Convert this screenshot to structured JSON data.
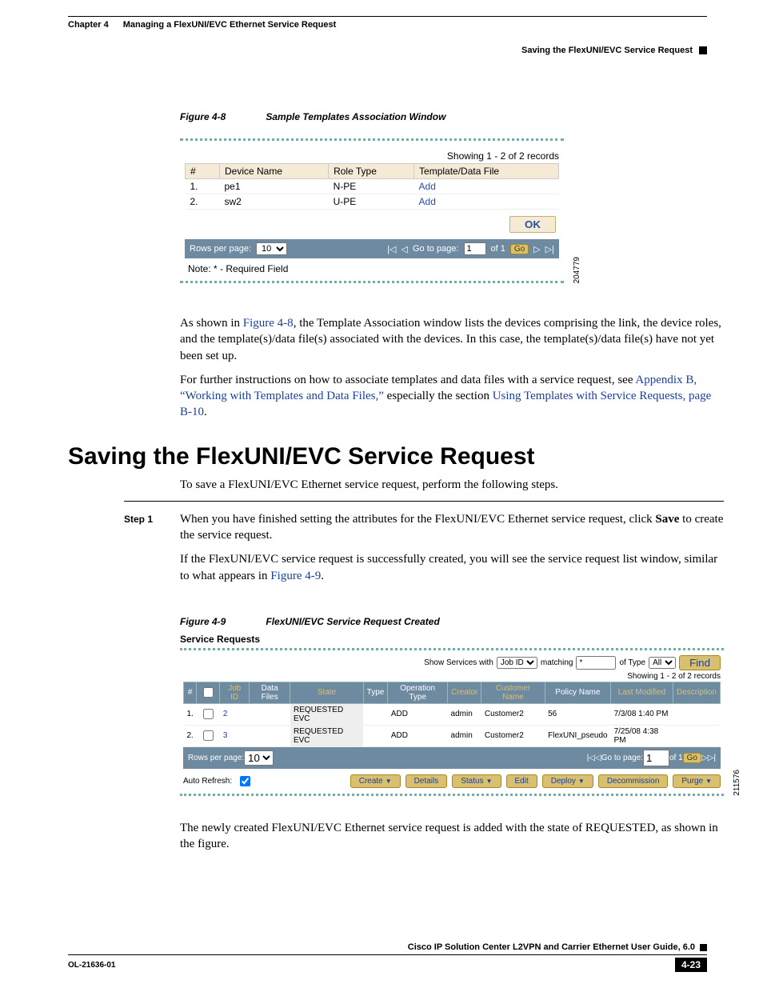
{
  "header": {
    "chapter": "Chapter 4",
    "title": "Managing a FlexUNI/EVC Ethernet Service Request",
    "subtitle": "Saving the FlexUNI/EVC Service Request"
  },
  "figure8": {
    "caption_num": "Figure 4-8",
    "caption_title": "Sample Templates Association Window",
    "records_label": "Showing 1 - 2 of 2 records",
    "col_num": "#",
    "col_device": "Device Name",
    "col_role": "Role Type",
    "col_template": "Template/Data File",
    "rows": [
      {
        "n": "1.",
        "device": "pe1",
        "role": "N-PE",
        "link": "Add"
      },
      {
        "n": "2.",
        "device": "sw2",
        "role": "U-PE",
        "link": "Add"
      }
    ],
    "ok": "OK",
    "rpp": "Rows per page:",
    "rpp_val": "10",
    "goto": "Go to page:",
    "goto_val": "1",
    "of": "of 1",
    "go": "Go",
    "note": "Note: * - Required Field",
    "side": "204779"
  },
  "para1_a": "As shown in ",
  "para1_link": "Figure 4-8",
  "para1_b": ", the Template Association window lists the devices comprising the link, the device roles, and the template(s)/data file(s) associated with the devices. In this case, the template(s)/data file(s) have not yet been set up.",
  "para2_a": "For further instructions on how to associate templates and data files with a service request, see ",
  "para2_link1": "Appendix B, “Working with Templates and Data Files,”",
  "para2_mid": " especially the section ",
  "para2_link2": "Using Templates with Service Requests, page B-10",
  "para2_end": ".",
  "section_title": "Saving the FlexUNI/EVC Service Request",
  "intro": "To save a FlexUNI/EVC Ethernet service request, perform the following steps.",
  "step1_label": "Step 1",
  "step1_text_a": "When you have finished setting the attributes for the FlexUNI/EVC Ethernet service request, click ",
  "step1_save": "Save",
  "step1_text_b": " to create the service request.",
  "step1_text2_a": "If the FlexUNI/EVC service request is successfully created, you will see the service request list window, similar to what appears in ",
  "step1_fig_link": "Figure 4-9",
  "step1_text2_b": ".",
  "figure9": {
    "caption_num": "Figure 4-9",
    "caption_title": "FlexUNI/EVC Service Request Created",
    "heading": "Service Requests",
    "show_services": "Show Services with",
    "jobid": "Job ID",
    "matching": "matching",
    "match_val": "*",
    "of_type": "of Type",
    "all": "All",
    "find": "Find",
    "records": "Showing 1 - 2 of 2 records",
    "cols": {
      "num": "#",
      "job": "Job ID",
      "data": "Data Files",
      "state": "State",
      "type": "Type",
      "op": "Operation Type",
      "creator": "Creator",
      "cust": "Customer Name",
      "policy": "Policy Name",
      "mod": "Last Modified",
      "desc": "Description"
    },
    "rows": [
      {
        "n": "1.",
        "job": "2",
        "state": "REQUESTED EVC",
        "op": "ADD",
        "creator": "admin",
        "cust": "Customer2",
        "policy": "56",
        "mod": "7/3/08 1:40 PM"
      },
      {
        "n": "2.",
        "job": "3",
        "state": "REQUESTED EVC",
        "op": "ADD",
        "creator": "admin",
        "cust": "Customer2",
        "policy": "FlexUNI_pseudo",
        "mod": "7/25/08 4:38 PM"
      }
    ],
    "rpp": "Rows per page:",
    "rpp_val": "10",
    "goto": "Go to page:",
    "goto_val": "1",
    "of": "of 1",
    "go": "Go",
    "auto": "Auto Refresh:",
    "btns": {
      "create": "Create",
      "details": "Details",
      "status": "Status",
      "edit": "Edit",
      "deploy": "Deploy",
      "decom": "Decommission",
      "purge": "Purge"
    },
    "side": "211576"
  },
  "para3": "The newly created FlexUNI/EVC Ethernet service request is added with the state of REQUESTED, as shown in the figure.",
  "footer": {
    "guide": "Cisco IP Solution Center L2VPN and Carrier Ethernet User Guide, 6.0",
    "doc": "OL-21636-01",
    "page": "4-23"
  }
}
